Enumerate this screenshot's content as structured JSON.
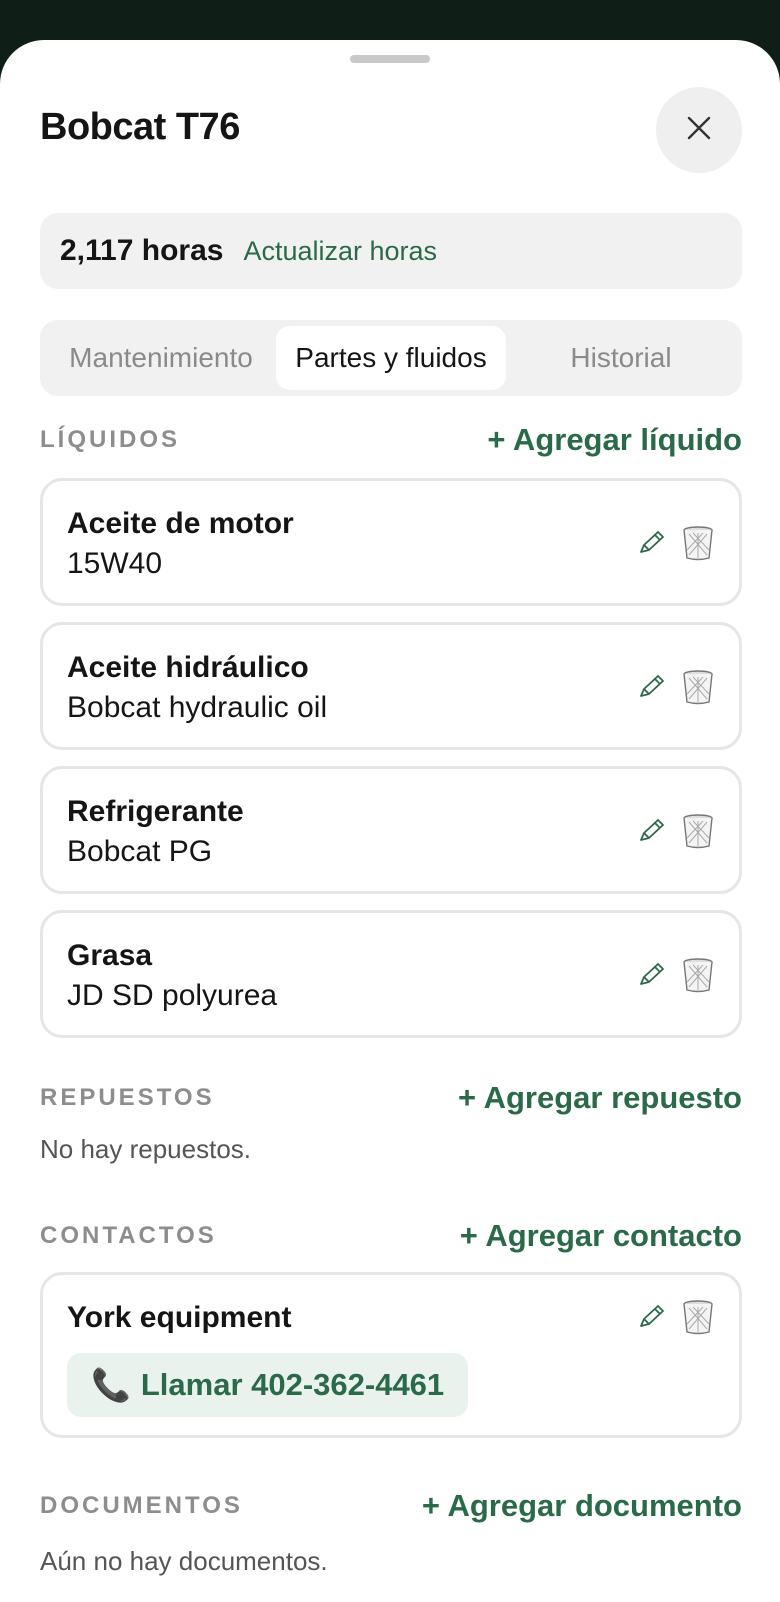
{
  "header": {
    "title": "Bobcat T76",
    "close_icon": "close-icon"
  },
  "hours": {
    "value": "2,117 horas",
    "update_link": "Actualizar horas"
  },
  "tabs": [
    {
      "label": "Mantenimiento",
      "active": false
    },
    {
      "label": "Partes y fluidos",
      "active": true
    },
    {
      "label": "Historial",
      "active": false
    }
  ],
  "liquids": {
    "label": "LÍQUIDOS",
    "add": "+ Agregar líquido",
    "items": [
      {
        "name": "Aceite de motor",
        "detail": "15W40"
      },
      {
        "name": "Aceite hidráulico",
        "detail": "Bobcat hydraulic oil"
      },
      {
        "name": "Refrigerante",
        "detail": "Bobcat PG"
      },
      {
        "name": "Grasa",
        "detail": "JD SD polyurea"
      }
    ]
  },
  "parts": {
    "label": "REPUESTOS",
    "add": "+ Agregar repuesto",
    "empty": "No hay repuestos."
  },
  "contacts": {
    "label": "CONTACTOS",
    "add": "+ Agregar contacto",
    "items": [
      {
        "name": "York equipment",
        "call_label": "Llamar 402-362-4461",
        "phone_icon": "📞"
      }
    ]
  },
  "documents": {
    "label": "DOCUMENTOS",
    "add": "+ Agregar documento",
    "empty": "Aún no hay documentos."
  },
  "colors": {
    "accent": "#2b6a48",
    "backdrop": "#0f1f18",
    "card_border": "#e6e6e6",
    "muted_bg": "#f1f1f1"
  }
}
